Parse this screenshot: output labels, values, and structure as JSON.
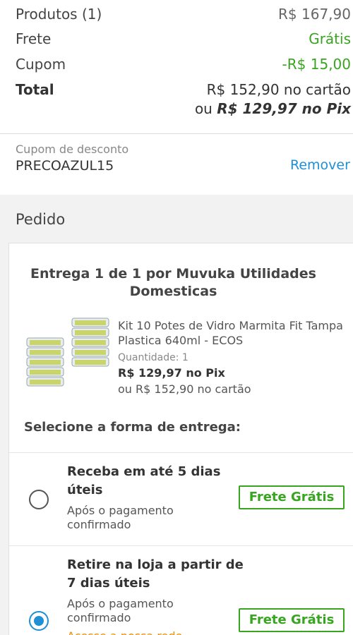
{
  "summary": {
    "products_label": "Produtos (1)",
    "products_value": "R$ 167,90",
    "shipping_label": "Frete",
    "shipping_value": "Grátis",
    "coupon_label": "Cupom",
    "coupon_value": "-R$ 15,00",
    "total_label": "Total",
    "total_card": "R$ 152,90 no cartão",
    "total_pix_prefix": "ou ",
    "total_pix": "R$ 129,97 no Pix"
  },
  "coupon": {
    "caption": "Cupom de desconto",
    "code": "PRECOAZUL15",
    "remove_label": "Remover"
  },
  "order": {
    "title": "Pedido",
    "seller_line": "Entrega 1 de 1 por Muvuka Utilidades Domesticas",
    "product": {
      "name": "Kit 10 Potes de Vidro Marmita Fit Tampa Plastica 640ml - ECOS",
      "quantity_label": "Quantidade:",
      "quantity_value": "1",
      "price_pix": "R$ 129,97 no Pix",
      "price_card": "ou R$ 152,90 no cartão"
    },
    "shipping_title": "Selecione a forma de entrega:",
    "options": [
      {
        "title": "Receba em até 5 dias úteis",
        "subtitle": "Após o pagamento confirmado",
        "badge": "Frete Grátis",
        "selected": false
      },
      {
        "title": "Retire na loja a partir de 7 dias úteis",
        "subtitle": "Após o pagamento confirmado",
        "badge": "Frete Grátis",
        "selected": true,
        "extra": "Acesse a nossa rede"
      }
    ]
  },
  "colors": {
    "green": "#38a520",
    "blue": "#1f8fd6",
    "orange": "#f08c00"
  }
}
